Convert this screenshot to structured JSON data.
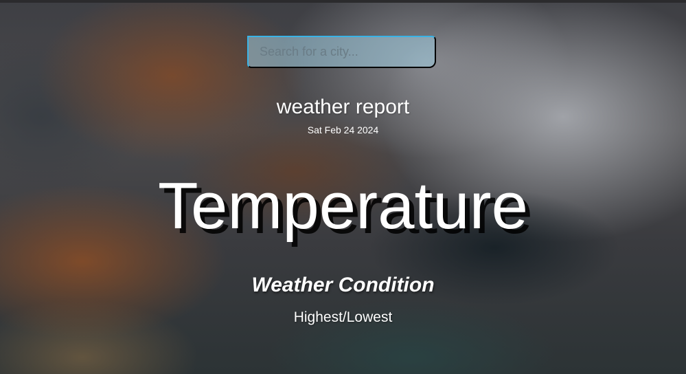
{
  "search": {
    "placeholder": "Search for a city...",
    "value": ""
  },
  "report": {
    "title": "weather report",
    "date": "Sat Feb 24 2024",
    "temperature": "Temperature",
    "condition": "Weather Condition",
    "high_low": "Highest/Lowest"
  },
  "colors": {
    "search_border_accent": "#3ab3e6",
    "text": "#ffffff"
  }
}
